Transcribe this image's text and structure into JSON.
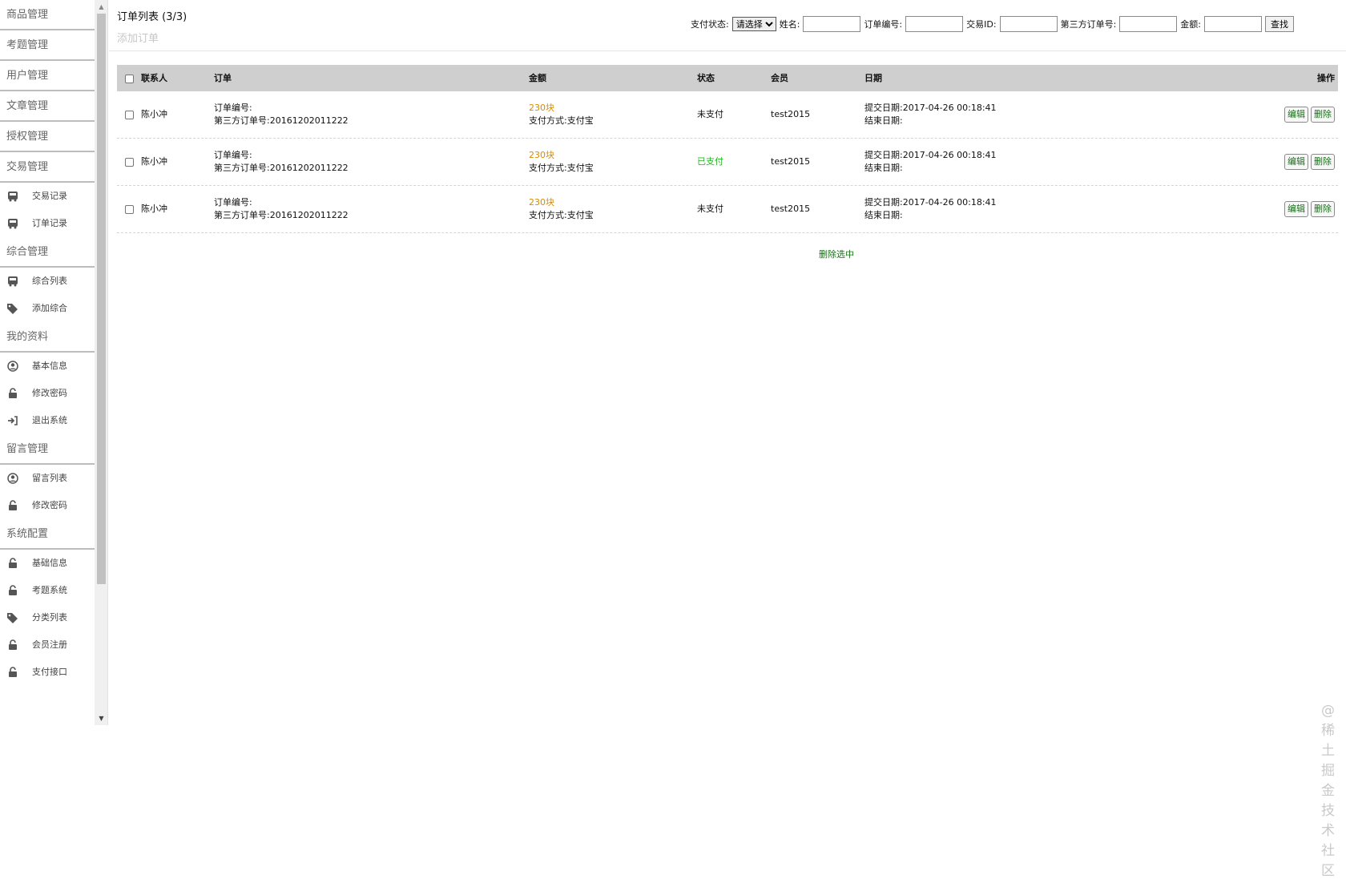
{
  "sidebar": {
    "sections": [
      {
        "title": "商品管理",
        "items": []
      },
      {
        "title": "考题管理",
        "items": []
      },
      {
        "title": "用户管理",
        "items": []
      },
      {
        "title": "文章管理",
        "items": []
      },
      {
        "title": "授权管理",
        "items": []
      },
      {
        "title": "交易管理",
        "items": [
          {
            "label": "交易记录",
            "icon": "bus-icon"
          },
          {
            "label": "订单记录",
            "icon": "bus-icon"
          }
        ]
      },
      {
        "title": "综合管理",
        "items": [
          {
            "label": "综合列表",
            "icon": "bus-icon"
          },
          {
            "label": "添加综合",
            "icon": "tags-icon"
          }
        ]
      },
      {
        "title": "我的资料",
        "items": [
          {
            "label": "基本信息",
            "icon": "user-circle-icon"
          },
          {
            "label": "修改密码",
            "icon": "unlock-icon"
          },
          {
            "label": "退出系统",
            "icon": "sign-in-icon"
          }
        ]
      },
      {
        "title": "留言管理",
        "items": [
          {
            "label": "留言列表",
            "icon": "user-circle-icon"
          },
          {
            "label": "修改密码",
            "icon": "unlock-icon"
          }
        ]
      },
      {
        "title": "系统配置",
        "items": [
          {
            "label": "基础信息",
            "icon": "unlock-icon"
          },
          {
            "label": "考题系统",
            "icon": "unlock-icon"
          },
          {
            "label": "分类列表",
            "icon": "tags-icon"
          },
          {
            "label": "会员注册",
            "icon": "unlock-icon"
          },
          {
            "label": "支付接口",
            "icon": "unlock-icon"
          }
        ]
      }
    ]
  },
  "header": {
    "title": "订单列表 (3/3)",
    "add_link": "添加订单"
  },
  "filter": {
    "pay_status_label": "支付状态:",
    "pay_status_value": "请选择",
    "name_label": "姓名:",
    "order_no_label": "订单编号:",
    "trade_id_label": "交易ID:",
    "third_order_label": "第三方订单号:",
    "amount_label": "金额:",
    "search_button": "查找"
  },
  "table": {
    "headers": {
      "contact": "联系人",
      "order": "订单",
      "amount": "金额",
      "status": "状态",
      "member": "会员",
      "date": "日期",
      "actions": "操作"
    },
    "rows": [
      {
        "contact": "陈小冲",
        "order_no": "订单编号:",
        "third_no": "第三方订单号:20161202011222",
        "amount": "230块",
        "pay_method": "支付方式:支付宝",
        "status": "未支付",
        "paid": false,
        "member": "test2015",
        "submit_date": "提交日期:2017-04-26 00:18:41",
        "end_date": "结束日期:"
      },
      {
        "contact": "陈小冲",
        "order_no": "订单编号:",
        "third_no": "第三方订单号:20161202011222",
        "amount": "230块",
        "pay_method": "支付方式:支付宝",
        "status": "已支付",
        "paid": true,
        "member": "test2015",
        "submit_date": "提交日期:2017-04-26 00:18:41",
        "end_date": "结束日期:"
      },
      {
        "contact": "陈小冲",
        "order_no": "订单编号:",
        "third_no": "第三方订单号:20161202011222",
        "amount": "230块",
        "pay_method": "支付方式:支付宝",
        "status": "未支付",
        "paid": false,
        "member": "test2015",
        "submit_date": "提交日期:2017-04-26 00:18:41",
        "end_date": "结束日期:"
      }
    ],
    "edit_label": "编辑",
    "delete_label": "删除",
    "delete_selected": "删除选中"
  },
  "watermark": "@稀土掘金技术社区",
  "colors": {
    "amount": "#d98b00",
    "paid_status": "#27b427",
    "action_text": "#1a6e1a",
    "table_header_bg": "#cfcfcf"
  }
}
